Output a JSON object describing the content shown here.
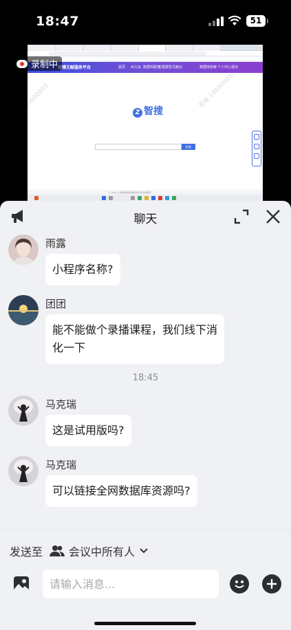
{
  "status_bar": {
    "time": "18:47",
    "battery": "51"
  },
  "shared_screen": {
    "site_logo": "德博文献服务平台",
    "nav_items": [
      "首页",
      "AI工具",
      "数据库服务",
      "主题报告",
      "文献云"
    ],
    "nav_right": [
      "数据库检索",
      "个人中心",
      "退出"
    ],
    "brand": "智搜",
    "search_button": "检索",
    "footer": "© 2024 上海德博信息科技有限公司 版权所有",
    "watermark_top": "无味",
    "watermark_number": "18690903"
  },
  "recording": {
    "label": "录制中"
  },
  "chat": {
    "title": "聊天",
    "messages": [
      {
        "sender": "雨露",
        "text": "小程序名称?"
      },
      {
        "sender": "团团",
        "text_lines": [
          "能不能做个录播课程，我们线下消",
          "化一下"
        ]
      },
      {
        "sender": "马克瑞",
        "text": "这是试用版吗?"
      },
      {
        "sender": "马克瑞",
        "text": "可以链接全网数据库资源吗?"
      }
    ],
    "time_separator": "18:45",
    "send_to_label": "发送至",
    "send_to_target": "会议中所有人",
    "input_placeholder": "请输入消息..."
  }
}
